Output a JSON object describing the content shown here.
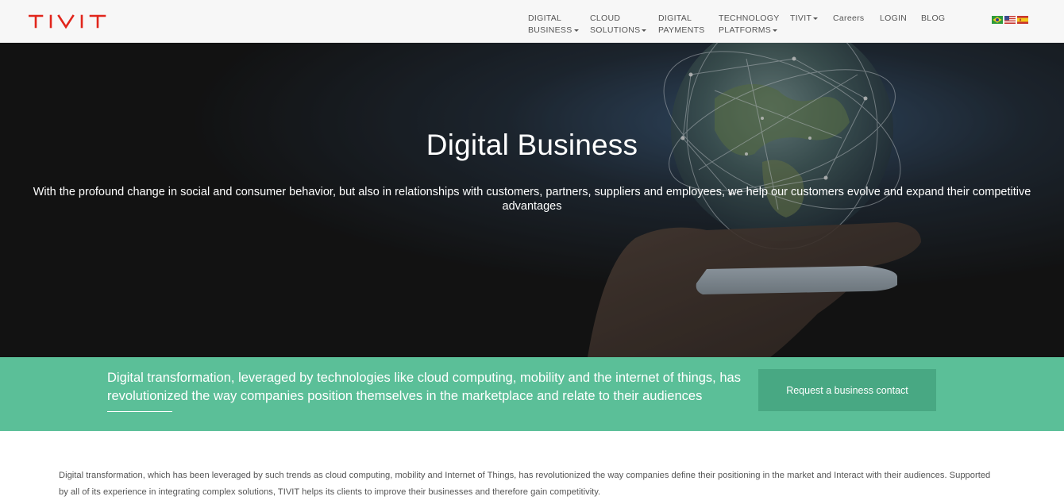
{
  "brand": {
    "logo_text": "TIVIT",
    "color": "#e1261c"
  },
  "nav": {
    "items": [
      {
        "line1": "DIGITAL",
        "line2": "BUSINESS",
        "dropdown": true
      },
      {
        "line1": "CLOUD",
        "line2": "SOLUTIONS",
        "dropdown": true
      },
      {
        "line1": "DIGITAL",
        "line2": "PAYMENTS",
        "dropdown": false
      },
      {
        "line1": "TECHNOLOGY",
        "line2": "PLATFORMS",
        "dropdown": true
      },
      {
        "line1": "TIVIT",
        "line2": "",
        "dropdown": true
      },
      {
        "line1": "Careers",
        "line2": "",
        "dropdown": false
      },
      {
        "line1": "LOGIN",
        "line2": "",
        "dropdown": false
      },
      {
        "line1": "BLOG",
        "line2": "",
        "dropdown": false
      }
    ],
    "flags": [
      "brazil-flag-icon",
      "usa-flag-icon",
      "spain-flag-icon"
    ]
  },
  "hero": {
    "title": "Digital Business",
    "text": "With the profound change in social and consumer behavior, but also in relationships with customers, partners, suppliers and employees, we help our customers evolve and expand their competitive advantages"
  },
  "band": {
    "text": "Digital transformation, leveraged by technologies like cloud computing, mobility and the internet of things, has revolutionized the way companies position themselves in the marketplace and relate to their audiences",
    "cta_label": "Request a business contact",
    "color": "#5bbf98",
    "cta_color": "#48a883"
  },
  "content": {
    "paragraph": "Digital transformation, which has been leveraged by such trends as cloud computing, mobility and Internet of Things, has revolutionized the way companies define their positioning in the market and Interact with their audiences. Supported by all of its experience in integrating complex solutions, TIVIT helps its clients to improve their businesses and therefore gain competitivity."
  }
}
